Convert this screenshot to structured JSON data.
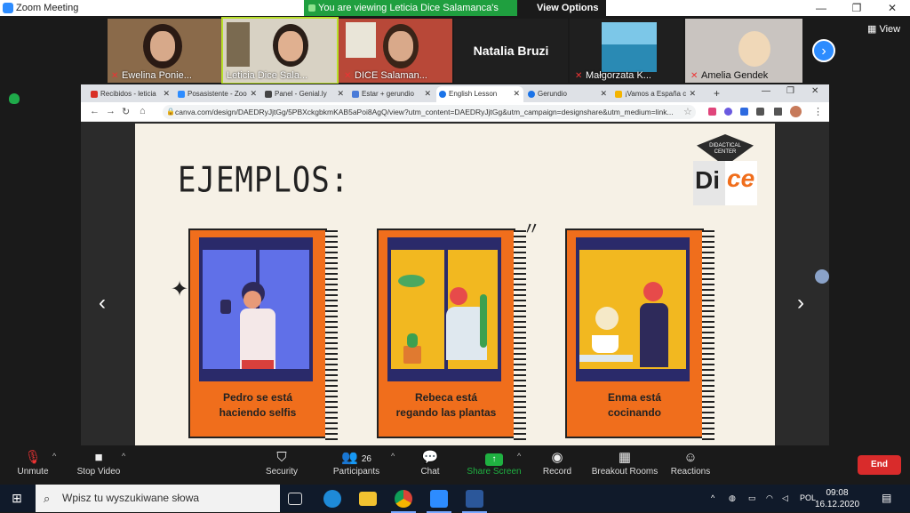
{
  "zoom": {
    "window_title": "Zoom Meeting",
    "banner_text": "You are viewing Leticia Dice Salamanca's screen",
    "view_options_label": "View Options",
    "view_label": "View",
    "participants": [
      {
        "name": "Ewelina Ponie..."
      },
      {
        "name": "Leticia Dice Sala..."
      },
      {
        "name": "DICE Salaman..."
      },
      {
        "name": "Natalia Bruzi"
      },
      {
        "name": "Małgorzata K..."
      },
      {
        "name": "Amelia Gendek"
      }
    ]
  },
  "browser": {
    "tabs": [
      {
        "label": "Recibidos - leticia",
        "color": "#d93025"
      },
      {
        "label": "Posasistente - Zoo",
        "color": "#2d8cff"
      },
      {
        "label": "Panel - Genial.ly",
        "color": "#444444"
      },
      {
        "label": "Estar + gerundio",
        "color": "#4a7bd8"
      },
      {
        "label": "English Lesson",
        "color": "#1a73e8"
      },
      {
        "label": "Gerundio",
        "color": "#1a73e8"
      },
      {
        "label": "¡Vamos a España c",
        "color": "#f4b400"
      }
    ],
    "url": "canva.com/design/DAEDRyJjtGg/5PBXckgbkmKAB5aPoi8AgQ/view?utm_content=DAEDRyJjtGg&utm_campaign=designshare&utm_medium=link..."
  },
  "slide": {
    "heading": "EJEMPLOS:",
    "logo_line1": "DIDACTICAL",
    "logo_line2": "CENTER",
    "logo_di": "Di",
    "logo_ce": "ce",
    "cards": [
      {
        "line1": "Pedro se está",
        "line2": "haciendo selfis"
      },
      {
        "line1": "Rebeca está",
        "line2": "regando las plantas"
      },
      {
        "line1": "Enma está",
        "line2": "cocinando"
      }
    ]
  },
  "toolbar": {
    "unmute": "Unmute",
    "stop_video": "Stop Video",
    "security": "Security",
    "participants": "Participants",
    "participants_count": "26",
    "chat": "Chat",
    "share_screen": "Share Screen",
    "record": "Record",
    "breakout": "Breakout Rooms",
    "reactions": "Reactions",
    "end": "End"
  },
  "taskbar": {
    "search_placeholder": "Wpisz tu wyszukiwane słowa",
    "lang": "POL",
    "time": "09:08",
    "date": "16.12.2020"
  },
  "colors": {
    "zoom_green": "#1f9f3f",
    "zoom_blue": "#2d8cff",
    "card_orange": "#f06e1c",
    "end_red": "#d92b2b"
  }
}
